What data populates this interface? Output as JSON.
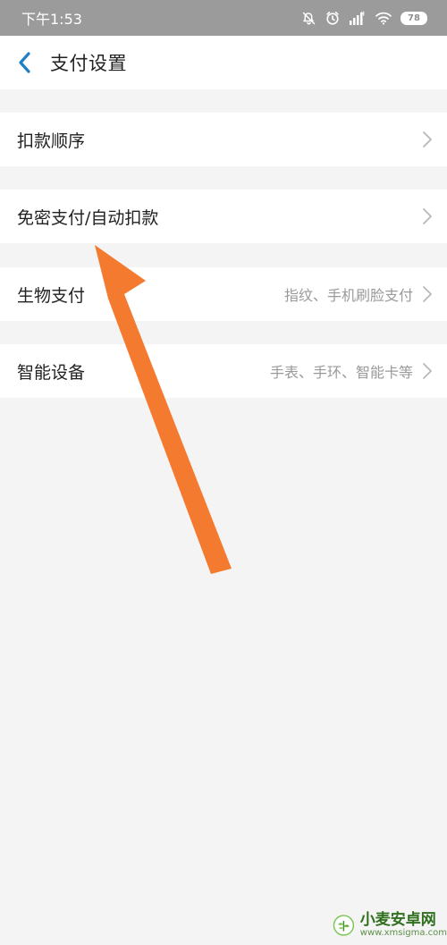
{
  "status_bar": {
    "time": "下午1:53",
    "battery": "78",
    "icons": [
      "mute-icon",
      "alarm-icon",
      "signal-icon",
      "wifi-icon",
      "battery-icon"
    ]
  },
  "nav": {
    "back_icon": "back-chevron-icon",
    "title": "支付设置"
  },
  "settings": [
    {
      "id": "deduction-order",
      "label": "扣款顺序",
      "detail": ""
    },
    {
      "id": "password-free-payment",
      "label": "免密支付/自动扣款",
      "detail": ""
    },
    {
      "id": "biometric-payment",
      "label": "生物支付",
      "detail": "指纹、手机刷脸支付"
    },
    {
      "id": "smart-devices",
      "label": "智能设备",
      "detail": "手表、手环、智能卡等"
    }
  ],
  "watermark": {
    "name": "小麦安卓网",
    "url": "www.xmsigma.com"
  },
  "colors": {
    "accent": "#1e7fc6",
    "annotation_arrow": "#f47a2f",
    "page_background": "#f4f4f4"
  }
}
